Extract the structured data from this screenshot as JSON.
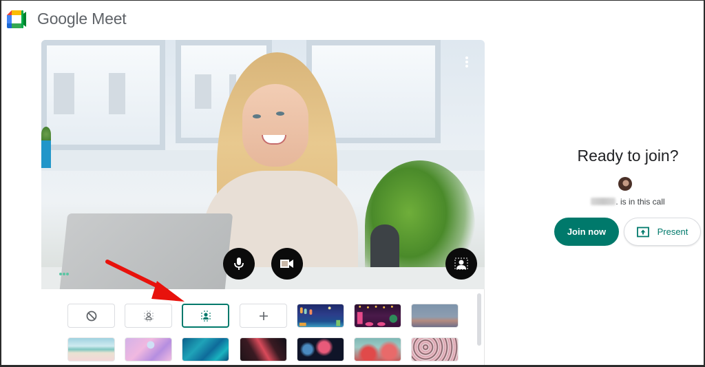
{
  "app": {
    "title": "Google Meet"
  },
  "preview": {
    "more_options_label": "More options",
    "controls": {
      "mic_label": "Turn off microphone",
      "camera_label": "Turn off camera",
      "background_label": "Apply visual effects"
    }
  },
  "backgrounds": {
    "options": [
      {
        "id": "none",
        "label": "Turn off visual effects",
        "icon": "block-icon"
      },
      {
        "id": "slight-blur",
        "label": "Slightly blur your background",
        "icon": "slight-blur-icon"
      },
      {
        "id": "blur",
        "label": "Blur your background",
        "icon": "blur-icon",
        "selected": true
      },
      {
        "id": "upload",
        "label": "Upload a background image",
        "icon": "plus-icon"
      },
      {
        "id": "lanterns",
        "label": "Lanterns night scene"
      },
      {
        "id": "festival",
        "label": "Festival bridge scene"
      },
      {
        "id": "sunset",
        "label": "Sunset horizon"
      },
      {
        "id": "beach",
        "label": "Beach"
      },
      {
        "id": "clouds",
        "label": "Pink clouds"
      },
      {
        "id": "water",
        "label": "Blue water"
      },
      {
        "id": "galaxy",
        "label": "Galaxy"
      },
      {
        "id": "fireworks",
        "label": "Fireworks"
      },
      {
        "id": "blossoms",
        "label": "Blossoms"
      },
      {
        "id": "flowers",
        "label": "Flowers"
      }
    ],
    "selected": "blur"
  },
  "join_panel": {
    "title": "Ready to join?",
    "in_call_text": ". is in this call",
    "join_button": "Join now",
    "present_button": "Present"
  },
  "colors": {
    "accent": "#00796b",
    "annotation_arrow": "#e8120c"
  }
}
